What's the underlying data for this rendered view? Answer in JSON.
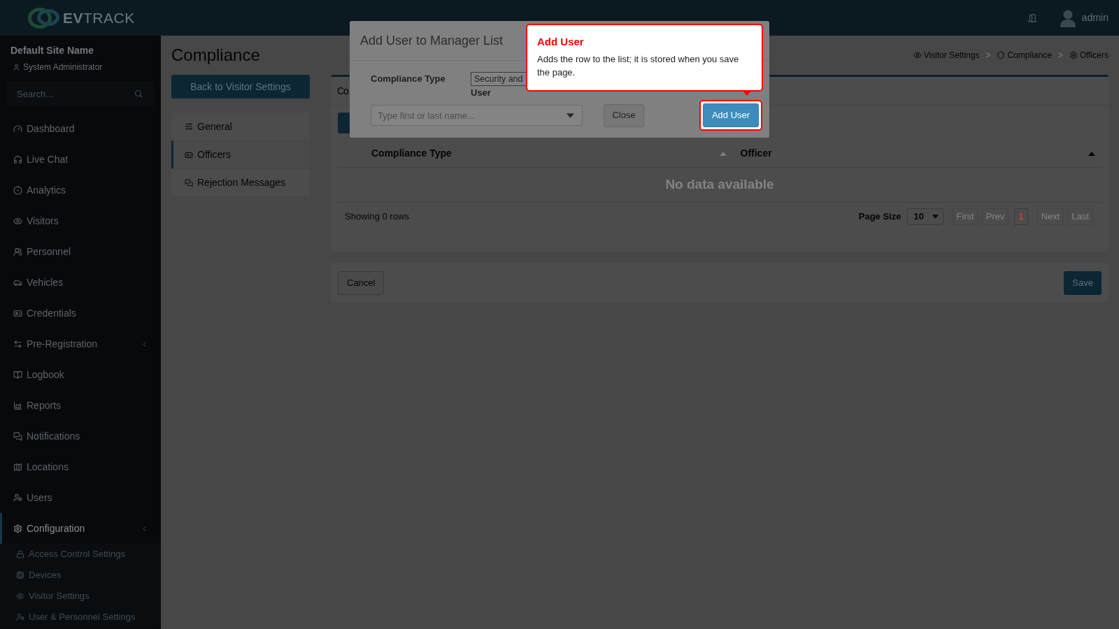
{
  "top_bar": {
    "logo_text": "**EV**TRACK",
    "user_name": "admin"
  },
  "sidebar": {
    "site_name": "Default Site Name",
    "role": "System Administrator",
    "search": {
      "placeholder": "Search..."
    },
    "items": [
      {
        "label": "Dashboard",
        "kind": "link",
        "selected": false
      },
      {
        "label": "Live Chat",
        "kind": "link",
        "selected": false
      },
      {
        "label": "Analytics",
        "kind": "link",
        "selected": false
      },
      {
        "label": "Visitors",
        "kind": "link",
        "selected": false
      },
      {
        "label": "Personnel",
        "kind": "link",
        "selected": false
      },
      {
        "label": "Vehicles",
        "kind": "link",
        "selected": false
      },
      {
        "label": "Credentials",
        "kind": "link",
        "selected": false
      },
      {
        "label": "Pre-Registration",
        "kind": "group",
        "selected": false
      },
      {
        "label": "Logbook",
        "kind": "link",
        "selected": false
      },
      {
        "label": "Reports",
        "kind": "link",
        "selected": false
      },
      {
        "label": "Notifications",
        "kind": "link",
        "selected": false
      },
      {
        "label": "Locations",
        "kind": "link",
        "selected": false
      },
      {
        "label": "Users",
        "kind": "link",
        "selected": false
      },
      {
        "label": "Configuration",
        "kind": "group",
        "selected": true,
        "children": [
          {
            "label": "Access Control Settings",
            "selected": false
          },
          {
            "label": "Devices",
            "selected": false
          },
          {
            "label": "Visitor Settings",
            "selected": false
          },
          {
            "label": "User & Personnel Settings",
            "selected": false
          }
        ]
      }
    ]
  },
  "page": {
    "title": "Compliance",
    "breadcrumb": [
      {
        "label": "Visitor Settings"
      },
      {
        "label": "Compliance"
      },
      {
        "label": "Officers"
      }
    ],
    "breadcrumb_separators": [
      ">",
      ">"
    ],
    "back_button": "Back to Visitor Settings",
    "section_menu": [
      {
        "label": "General",
        "selected": false
      },
      {
        "label": "Officers",
        "selected": true
      },
      {
        "label": "Rejection Messages",
        "selected": false
      }
    ]
  },
  "officers_card": {
    "title": "Co",
    "table": {
      "columns": [
        {
          "label": "Compliance Type",
          "sorted": false
        },
        {
          "label": "Officer",
          "sorted": true
        }
      ],
      "empty_text": "No data available"
    },
    "footer": {
      "summary": "Showing 0 rows",
      "page_size_label": "Page Size",
      "page_size": "10",
      "pager": [
        {
          "label": "First",
          "kind": "nav",
          "disabled": true
        },
        {
          "label": "Prev",
          "kind": "nav",
          "disabled": true
        },
        {
          "label": "1",
          "kind": "page",
          "selected": true
        },
        {
          "label": "Next",
          "kind": "nav",
          "disabled": true
        },
        {
          "label": "Last",
          "kind": "nav",
          "disabled": true
        }
      ]
    }
  },
  "form_actions": {
    "cancel": "Cancel",
    "save": "Save"
  },
  "modal": {
    "title": "Add User to Manager List",
    "compliance_type": {
      "label": "Compliance Type",
      "value": "Security and"
    },
    "user": {
      "label": "User",
      "placeholder": "Type first or last name..."
    },
    "close_button": "Close",
    "add_button": "Add User"
  },
  "tooltip": {
    "title": "Add User",
    "text": "Adds the row to the list; it is stored when you save the page."
  }
}
